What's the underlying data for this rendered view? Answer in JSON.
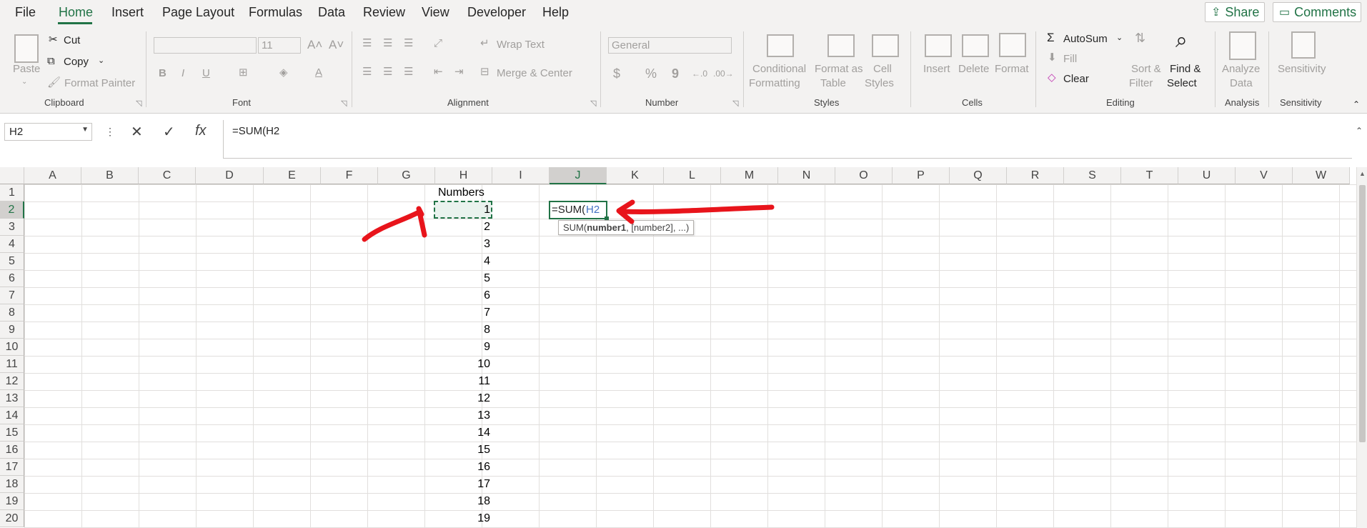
{
  "menu": {
    "tabs": [
      "File",
      "Home",
      "Insert",
      "Page Layout",
      "Formulas",
      "Data",
      "Review",
      "View",
      "Developer",
      "Help"
    ],
    "active": "Home",
    "share_label": "Share",
    "comments_label": "Comments"
  },
  "ribbon": {
    "clipboard": {
      "paste": "Paste",
      "cut": "Cut",
      "copy": "Copy",
      "format_painter": "Format Painter",
      "label": "Clipboard"
    },
    "font": {
      "size": "11",
      "bold": "B",
      "italic": "I",
      "underline": "U",
      "label": "Font"
    },
    "alignment": {
      "wrap_text": "Wrap Text",
      "merge_center": "Merge & Center",
      "label": "Alignment"
    },
    "number": {
      "format": "General",
      "currency": "$",
      "percent": "%",
      "comma": "9",
      "label": "Number"
    },
    "styles": {
      "conditional_1": "Conditional",
      "conditional_2": "Formatting",
      "format_table_1": "Format as",
      "format_table_2": "Table",
      "cell_styles_1": "Cell",
      "cell_styles_2": "Styles",
      "label": "Styles"
    },
    "cells": {
      "insert": "Insert",
      "delete": "Delete",
      "format": "Format",
      "label": "Cells"
    },
    "editing": {
      "autosum": "AutoSum",
      "fill": "Fill",
      "clear": "Clear",
      "sort_1": "Sort &",
      "sort_2": "Filter",
      "find_1": "Find &",
      "find_2": "Select",
      "label": "Editing"
    },
    "analysis": {
      "analyze_1": "Analyze",
      "analyze_2": "Data",
      "label": "Analysis"
    },
    "sensitivity": {
      "button": "Sensitivity",
      "label": "Sensitivity"
    }
  },
  "formula_bar": {
    "name_box": "H2",
    "formula": "=SUM(H2"
  },
  "sheet": {
    "columns": [
      "A",
      "B",
      "C",
      "D",
      "E",
      "F",
      "G",
      "H",
      "I",
      "J",
      "K",
      "L",
      "M",
      "N",
      "O",
      "P",
      "Q",
      "R",
      "S",
      "T",
      "U",
      "V",
      "W"
    ],
    "rows": [
      "1",
      "2",
      "3",
      "4",
      "5",
      "6",
      "7",
      "8",
      "9",
      "10",
      "11",
      "12",
      "13",
      "14",
      "15",
      "16",
      "17",
      "18",
      "19",
      "20"
    ],
    "header_h1": "Numbers",
    "h_values": [
      "1",
      "2",
      "3",
      "4",
      "5",
      "6",
      "7",
      "8",
      "9",
      "10",
      "11",
      "12",
      "13",
      "14",
      "15",
      "16",
      "17",
      "18",
      "19"
    ],
    "active_cell_prefix": "=SUM(",
    "active_cell_ref": "H2",
    "tooltip_prefix": "SUM(",
    "tooltip_bold": "number1",
    "tooltip_rest": ", [number2], ...)"
  },
  "colors": {
    "accent": "#217346",
    "annotation": "#e8141b",
    "ref": "#4472c4"
  }
}
